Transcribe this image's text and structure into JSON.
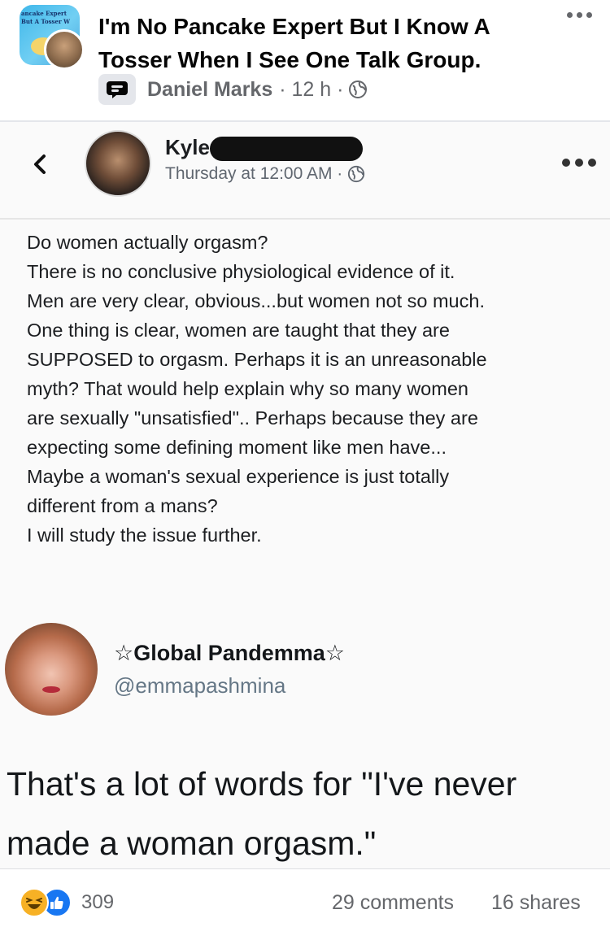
{
  "post": {
    "group_title": "I'm No Pancake Expert But I Know A Tosser When I See One Talk Group.",
    "group_avatar_text": "ancake Expert But A Tosser W",
    "author": "Daniel Marks",
    "meta": "· 12 h ·"
  },
  "screenshot": {
    "kyle": {
      "name": "Kyle",
      "time": "Thursday at 12:00 AM ·",
      "lines": [
        "Do women actually orgasm?",
        "There is no conclusive physiological evidence of it.",
        "Men are very clear, obvious...but women not so much.",
        "One thing is clear, women are taught that they are",
        "SUPPOSED to orgasm.  Perhaps it is an unreasonable",
        "myth?  That would help explain why so many women",
        "are sexually \"unsatisfied\".. Perhaps because they are",
        "expecting some defining moment like men have...",
        "Maybe a woman's sexual experience is just totally",
        "different from a mans?",
        "I will study the issue further."
      ]
    },
    "tweet": {
      "name": "☆Global Pandemma☆",
      "handle": "@emmapashmina",
      "lines": [
        "That's a lot of words for \"I've never",
        "made a woman orgasm.\""
      ]
    }
  },
  "footer": {
    "reaction_count": "309",
    "comments": "29 comments",
    "shares": "16 shares"
  },
  "colors": {
    "facebook_blue": "#1877f2",
    "haha_yellow": "#f7b125",
    "secondary_text": "#65676b"
  },
  "icons": [
    "more-icon",
    "group-badge-icon",
    "globe-icon",
    "back-icon",
    "haha-reaction-icon",
    "like-reaction-icon"
  ]
}
